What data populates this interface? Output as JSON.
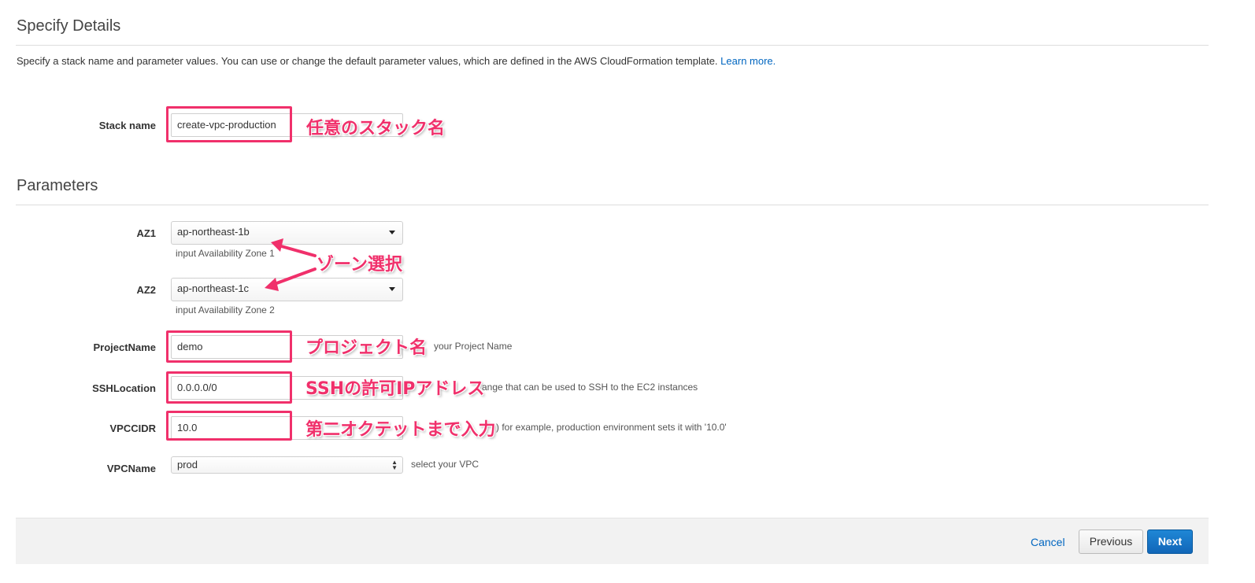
{
  "details": {
    "title": "Specify Details",
    "description": "Specify a stack name and parameter values. You can use or change the default parameter values, which are defined in the AWS CloudFormation template.",
    "learn_more": "Learn more."
  },
  "stack": {
    "label": "Stack name",
    "value": "create-vpc-production"
  },
  "parameters": {
    "title": "Parameters",
    "az1": {
      "label": "AZ1",
      "value": "ap-northeast-1b",
      "hint": "input Availability Zone 1"
    },
    "az2": {
      "label": "AZ2",
      "value": "ap-northeast-1c",
      "hint": "input Availability Zone 2"
    },
    "project_name": {
      "label": "ProjectName",
      "value": "demo",
      "hint": "your Project Name"
    },
    "ssh_location": {
      "label": "SSHLocation",
      "value": "0.0.0.0/0",
      "hint": "ange that can be used to SSH to the EC2 instances"
    },
    "vpc_cidr": {
      "label": "VPCCIDR",
      "value": "10.0",
      "hint": ") for example, production environment sets it with '10.0'"
    },
    "vpc_name": {
      "label": "VPCName",
      "value": "prod",
      "hint": "select your VPC"
    }
  },
  "annotations": {
    "stack_name": "任意のスタック名",
    "az_select": "ゾーン選択",
    "project_name": "プロジェクト名",
    "ssh_location": "SSHの許可IPアドレス",
    "vpc_cidr": "第二オクテットまで入力"
  },
  "footer": {
    "cancel": "Cancel",
    "previous": "Previous",
    "next": "Next"
  },
  "colors": {
    "annotation": "#f0306b",
    "link": "#0066c0",
    "primary_button": "#1f87d6"
  }
}
